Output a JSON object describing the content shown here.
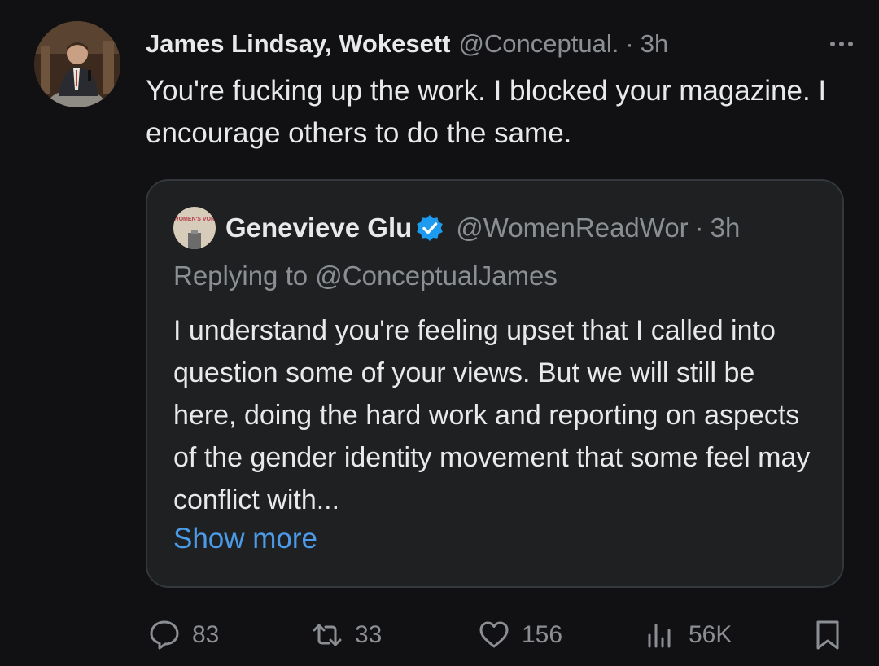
{
  "tweet": {
    "author_name": "James Lindsay, Wokesett",
    "author_handle": "@Conceptual.",
    "separator": "·",
    "time": "3h",
    "text": "You're fucking up the work. I blocked your magazine. I encourage others to do the same."
  },
  "quoted_tweet": {
    "avatar_label": "WOMEN'S VOICES",
    "author_name": "Genevieve Glu",
    "author_handle": "@WomenReadWor",
    "separator": "·",
    "time": "3h",
    "replying_to": "Replying to @ConceptualJames",
    "text": "I understand you're feeling upset that I called into question some of your views. But we will still be here, doing the hard work and reporting on aspects of the gender identity movement that some feel may conflict with...",
    "show_more_label": "Show more"
  },
  "actions": {
    "replies": "83",
    "reposts": "33",
    "likes": "156",
    "views": "56K"
  },
  "colors": {
    "background": "#111113",
    "text": "#e7e9ea",
    "muted": "#8b8f94",
    "link": "#4c9be8",
    "verified": "#1d9bf0",
    "quote_border": "#34373c"
  }
}
